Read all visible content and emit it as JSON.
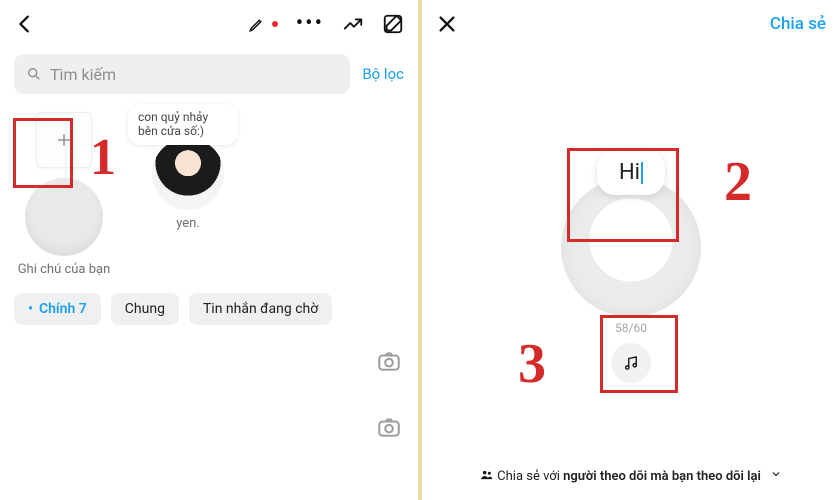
{
  "left": {
    "search_placeholder": "Tìm kiếm",
    "filter_label": "Bộ lọc",
    "notes": {
      "mine_caption": "Ghi chú của bạn",
      "friend_name": "yen.",
      "friend_bubble": "con quỷ nhảy bên cửa số:)"
    },
    "tabs": {
      "primary": "Chính 7",
      "general": "Chung",
      "requests": "Tin nhắn đang chờ"
    }
  },
  "right": {
    "share_label": "Chia sẻ",
    "input_text": "Hi",
    "counter": "58/60",
    "share_with_prefix": "Chia sẻ với ",
    "share_with_bold": "người theo dõi mà bạn theo dõi lại"
  },
  "annotations": {
    "n1": "1",
    "n2": "2",
    "n3": "3"
  }
}
